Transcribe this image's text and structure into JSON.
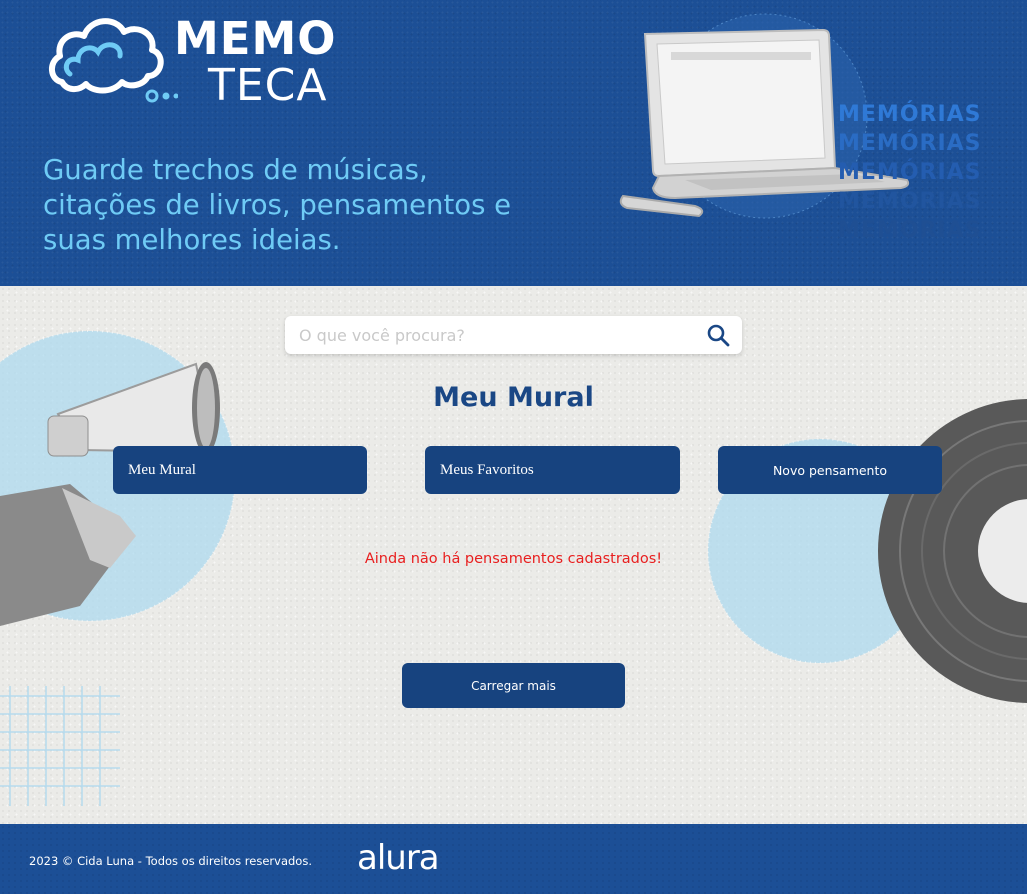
{
  "header": {
    "logo": {
      "line1": "MEMO",
      "line2": "TECA"
    },
    "tagline": "Guarde trechos de músicas, citações de livros, pensamentos e suas melhores ideias.",
    "decor_words": [
      "MEMÓRIAS",
      "MEMÓRIAS",
      "MEMÓRIAS",
      "MEMÓRIAS",
      "MEMÓRIAS"
    ]
  },
  "search": {
    "placeholder": "O que você procura?",
    "icon": "search-icon"
  },
  "main": {
    "title": "Meu Mural",
    "buttons": {
      "mural": "Meu Mural",
      "favorites": "Meus Favoritos",
      "new_thought": "Novo pensamento"
    },
    "empty_message": "Ainda não há pensamentos cadastrados!",
    "load_more": "Carregar mais"
  },
  "footer": {
    "copyright": "2023 © Cida Luna - Todos os direitos reservados.",
    "brand": "alura"
  },
  "colors": {
    "header_bg": "#1c4f96",
    "tagline": "#6fcbf5",
    "button_bg": "#17437f",
    "title": "#1a4785",
    "empty_message": "#e81f1f",
    "page_bg": "#ebebe8"
  }
}
